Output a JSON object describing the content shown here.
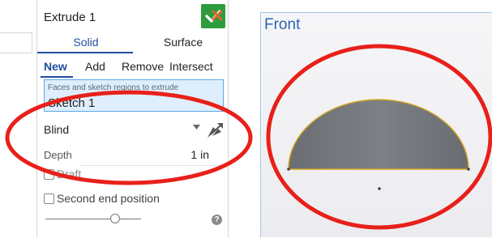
{
  "dialog": {
    "title": "Extrude 1",
    "tabs": [
      {
        "label": "Solid",
        "active": true
      },
      {
        "label": "Surface",
        "active": false
      }
    ],
    "operations": [
      {
        "label": "New",
        "active": true
      },
      {
        "label": "Add",
        "active": false
      },
      {
        "label": "Remove",
        "active": false
      },
      {
        "label": "Intersect",
        "active": false
      }
    ],
    "faces_field": {
      "caption": "Faces and sketch regions to extrude",
      "value": "Sketch 1"
    },
    "end_type": {
      "value": "Blind"
    },
    "depth": {
      "label": "Depth",
      "value": "1 in"
    },
    "draft": {
      "label": "Draft",
      "checked": false
    },
    "second_end": {
      "label": "Second end position",
      "checked": false
    },
    "help": "?"
  },
  "viewport": {
    "label": "Front"
  },
  "colors": {
    "accent": "#1f4e9c",
    "ok_green": "#2e9c3e",
    "cancel_orange": "#e2642c",
    "annotation_red": "#e8201a",
    "view_label_blue": "#2d64b3",
    "sketch_edge": "#d5a520",
    "solid_gray": "#6f7378"
  },
  "icons": [
    "check-icon",
    "close-icon",
    "chevron-down-icon",
    "flip-direction-icon",
    "help-icon"
  ]
}
